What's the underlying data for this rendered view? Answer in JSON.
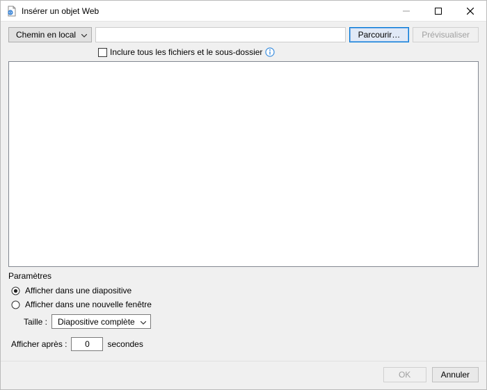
{
  "window_title": "Insérer un objet Web",
  "path_type_label": "Chemin en local",
  "path_value": "",
  "browse_label": "Parcourir…",
  "preview_label": "Prévisualiser",
  "include_all_label": "Inclure tous les fichiers et le sous-dossier",
  "params": {
    "heading": "Paramètres",
    "display_in_slide": "Afficher dans une diapositive",
    "display_new_window": "Afficher dans une nouvelle fenêtre",
    "size_label": "Taille :",
    "size_selected": "Diapositive complète",
    "display_after_prefix": "Afficher après :",
    "display_after_value": "0",
    "display_after_suffix": "secondes"
  },
  "footer": {
    "ok": "OK",
    "cancel": "Annuler"
  }
}
